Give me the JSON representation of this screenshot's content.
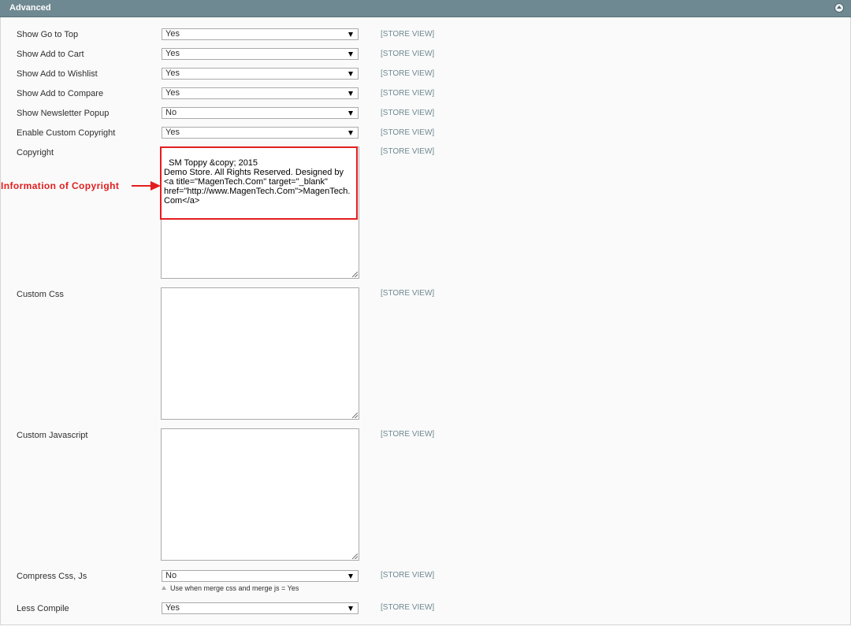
{
  "section": {
    "title": "Advanced",
    "collapse_icon": "collapse-up-icon"
  },
  "fields": {
    "show_go_to_top": {
      "label": "Show Go to Top",
      "value": "Yes",
      "scope": "[STORE VIEW]"
    },
    "show_add_to_cart": {
      "label": "Show Add to Cart",
      "value": "Yes",
      "scope": "[STORE VIEW]"
    },
    "show_add_to_wishlist": {
      "label": "Show Add to Wishlist",
      "value": "Yes",
      "scope": "[STORE VIEW]"
    },
    "show_add_to_compare": {
      "label": "Show Add to Compare",
      "value": "Yes",
      "scope": "[STORE VIEW]"
    },
    "show_newsletter_popup": {
      "label": "Show Newsletter Popup",
      "value": "No",
      "scope": "[STORE VIEW]"
    },
    "enable_custom_copyright": {
      "label": "Enable Custom Copyright",
      "value": "Yes",
      "scope": "[STORE VIEW]"
    },
    "copyright": {
      "label": "Copyright",
      "value": "SM Toppy &copy; 2015\nDemo Store. All Rights Reserved. Designed by\n<a title=\"MagenTech.Com\" target=\"_blank\"\nhref=\"http://www.MagenTech.Com\">MagenTech.Com</a>",
      "scope": "[STORE VIEW]"
    },
    "custom_css": {
      "label": "Custom Css",
      "value": "",
      "scope": "[STORE VIEW]"
    },
    "custom_javascript": {
      "label": "Custom Javascript",
      "value": "",
      "scope": "[STORE VIEW]"
    },
    "compress_css_js": {
      "label": "Compress Css, Js",
      "value": "No",
      "hint": "Use when merge css and merge js = Yes",
      "scope": "[STORE VIEW]"
    },
    "less_compile": {
      "label": "Less Compile",
      "value": "Yes",
      "scope": "[STORE VIEW]"
    }
  },
  "annotation": {
    "text": "Information of Copyright",
    "color": "#e31d1d"
  },
  "colors": {
    "header_bg": "#6f8992",
    "scope_text": "#6f8992",
    "annotation_red": "#e31d1d"
  }
}
